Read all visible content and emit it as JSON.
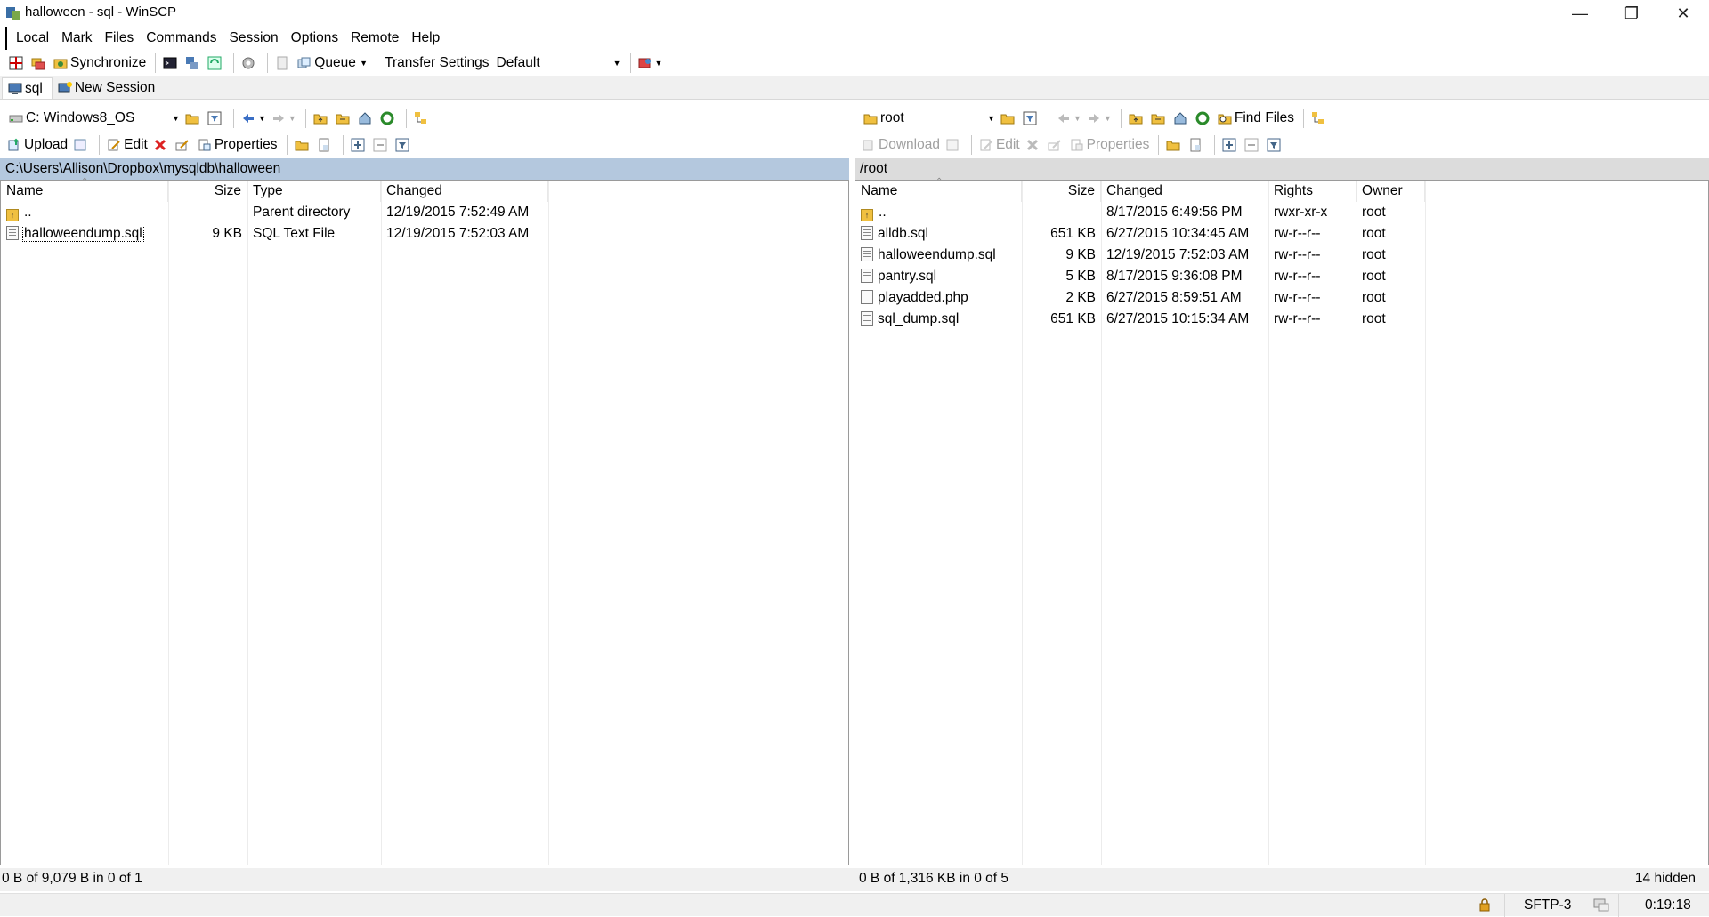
{
  "window": {
    "title": "halloween - sql - WinSCP",
    "minimize": "—",
    "restore": "❐",
    "close": "✕"
  },
  "menu": [
    "Local",
    "Mark",
    "Files",
    "Commands",
    "Session",
    "Options",
    "Remote",
    "Help"
  ],
  "toolbar": {
    "synchronize": "Synchronize",
    "queue": "Queue",
    "transfer_settings_label": "Transfer Settings",
    "transfer_settings_value": "Default"
  },
  "tabs": {
    "session": "sql",
    "new_session": "New Session"
  },
  "local": {
    "drive": "C: Windows8_OS",
    "upload": "Upload",
    "edit": "Edit",
    "properties": "Properties",
    "path": "C:\\Users\\Allison\\Dropbox\\mysqldb\\halloween",
    "columns": {
      "name": "Name",
      "size": "Size",
      "type": "Type",
      "changed": "Changed"
    },
    "files": [
      {
        "name": "..",
        "size": "",
        "type": "Parent directory",
        "changed": "12/19/2015  7:52:49 AM"
      },
      {
        "name": "halloweendump.sql",
        "size": "9 KB",
        "type": "SQL Text File",
        "changed": "12/19/2015  7:52:03 AM"
      }
    ],
    "status": "0 B of 9,079 B in 0 of 1"
  },
  "remote": {
    "dir": "root",
    "download": "Download",
    "edit": "Edit",
    "properties": "Properties",
    "find_files": "Find Files",
    "path": "/root",
    "columns": {
      "name": "Name",
      "size": "Size",
      "changed": "Changed",
      "rights": "Rights",
      "owner": "Owner"
    },
    "files": [
      {
        "name": "..",
        "size": "",
        "changed": "8/17/2015 6:49:56 PM",
        "rights": "rwxr-xr-x",
        "owner": "root",
        "icon": "updir"
      },
      {
        "name": "alldb.sql",
        "size": "651 KB",
        "changed": "6/27/2015 10:34:45 AM",
        "rights": "rw-r--r--",
        "owner": "root",
        "icon": "sql"
      },
      {
        "name": "halloweendump.sql",
        "size": "9 KB",
        "changed": "12/19/2015 7:52:03 AM",
        "rights": "rw-r--r--",
        "owner": "root",
        "icon": "sql"
      },
      {
        "name": "pantry.sql",
        "size": "5 KB",
        "changed": "8/17/2015 9:36:08 PM",
        "rights": "rw-r--r--",
        "owner": "root",
        "icon": "sql"
      },
      {
        "name": "playadded.php",
        "size": "2 KB",
        "changed": "6/27/2015 8:59:51 AM",
        "rights": "rw-r--r--",
        "owner": "root",
        "icon": "file"
      },
      {
        "name": "sql_dump.sql",
        "size": "651 KB",
        "changed": "6/27/2015 10:15:34 AM",
        "rights": "rw-r--r--",
        "owner": "root",
        "icon": "sql"
      }
    ],
    "status": "0 B of 1,316 KB in 0 of 5",
    "hidden": "14 hidden"
  },
  "statusbar": {
    "protocol": "SFTP-3",
    "time": "0:19:18"
  },
  "colors": {
    "local_path_bg": "#b4c8de",
    "remote_path_bg": "#dcdcdc"
  }
}
